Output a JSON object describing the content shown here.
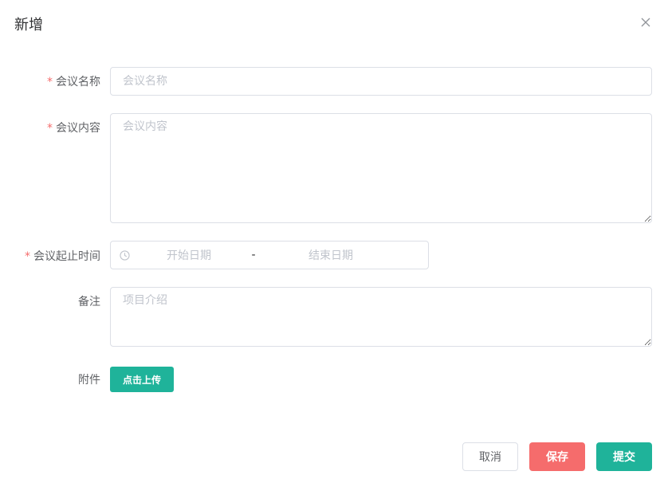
{
  "dialog": {
    "title": "新增",
    "close_icon": "close-icon"
  },
  "form": {
    "meeting_name": {
      "label": "会议名称",
      "required": true,
      "value": "",
      "placeholder": "会议名称"
    },
    "meeting_content": {
      "label": "会议内容",
      "required": true,
      "value": "",
      "placeholder": "会议内容"
    },
    "meeting_time": {
      "label": "会议起止时间",
      "required": true,
      "icon": "clock-icon",
      "start_placeholder": "开始日期",
      "separator": "-",
      "end_placeholder": "结束日期"
    },
    "remarks": {
      "label": "备注",
      "required": false,
      "value": "",
      "placeholder": "项目介绍"
    },
    "attachment": {
      "label": "附件",
      "upload_label": "点击上传"
    },
    "required_mark": "*"
  },
  "footer": {
    "cancel_label": "取消",
    "save_label": "保存",
    "submit_label": "提交"
  },
  "colors": {
    "primary": "#1fb39a",
    "danger": "#f56c6c",
    "border": "#dcdfe6",
    "placeholder": "#c0c4cc"
  }
}
